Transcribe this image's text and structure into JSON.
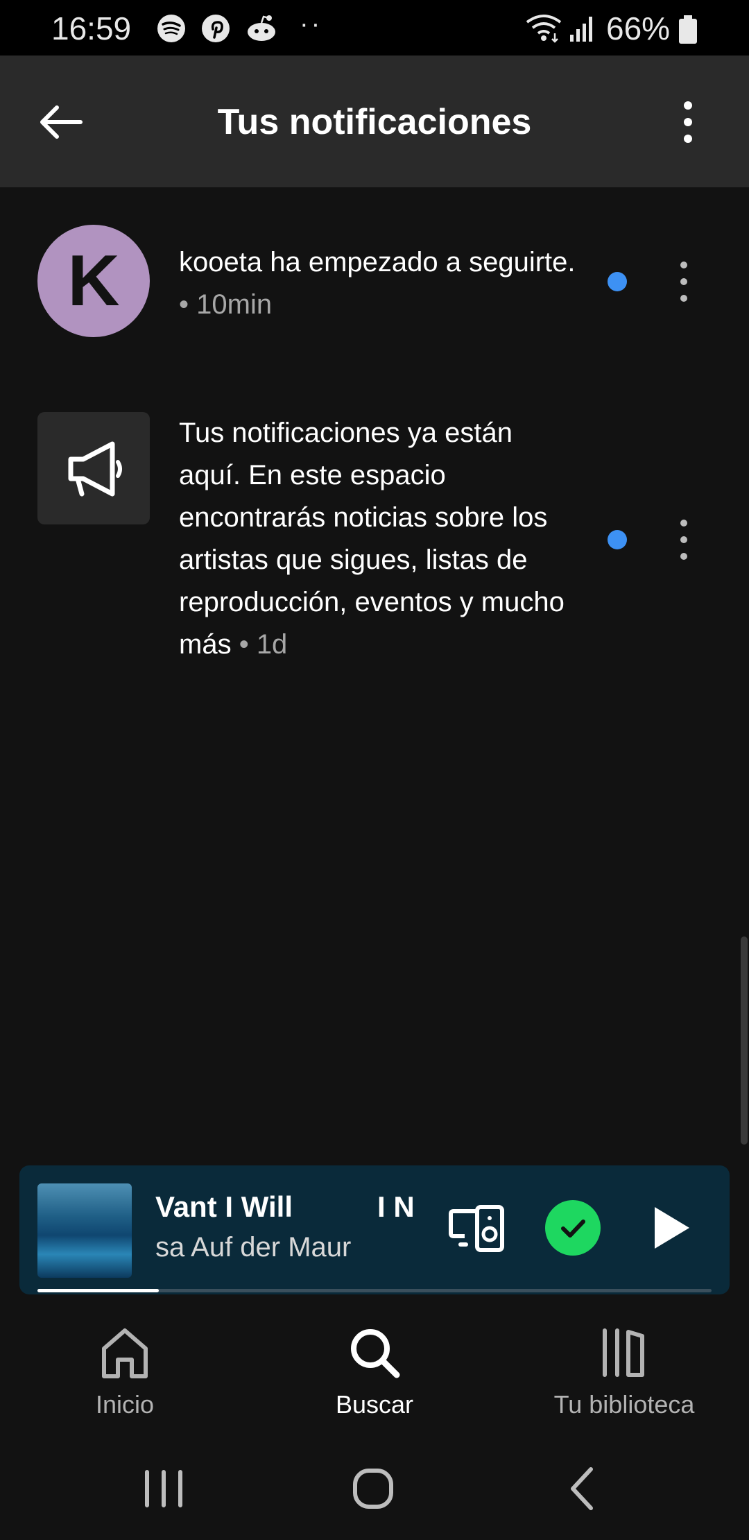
{
  "status_bar": {
    "time": "16:59",
    "app_icons": [
      "spotify-icon",
      "pinterest-icon",
      "reddit-icon"
    ],
    "more": "··",
    "battery": "66%"
  },
  "header": {
    "title": "Tus notificaciones"
  },
  "notifications": [
    {
      "avatar_letter": "K",
      "avatar_color": "#b193c0",
      "text": "kooeta ha empezado a seguirte.",
      "separator": " • ",
      "time": "10min",
      "unread": true
    },
    {
      "icon": "megaphone-icon",
      "text": "Tus notificaciones ya están aquí. En este espacio encontrarás noticias sobre los artistas que sigues, listas de reproducción, eventos y mucho más",
      "separator": " • ",
      "time": "1d",
      "unread": true
    }
  ],
  "mini_player": {
    "title_visible": "Vant I Will",
    "title_next_visible": "I N",
    "artist_visible": "sa Auf der Maur",
    "saved": true,
    "progress": 0.18,
    "colors": {
      "background": "#0a2a3a",
      "saved": "#1ed760"
    }
  },
  "bottom_nav": [
    {
      "label": "Inicio",
      "icon": "home-icon",
      "active": false
    },
    {
      "label": "Buscar",
      "icon": "search-icon",
      "active": true
    },
    {
      "label": "Tu biblioteca",
      "icon": "library-icon",
      "active": false
    }
  ],
  "colors": {
    "background": "#121212",
    "header": "#2a2a2a",
    "unread_dot": "#3d91f4",
    "meta_text": "#a7a7a7"
  }
}
